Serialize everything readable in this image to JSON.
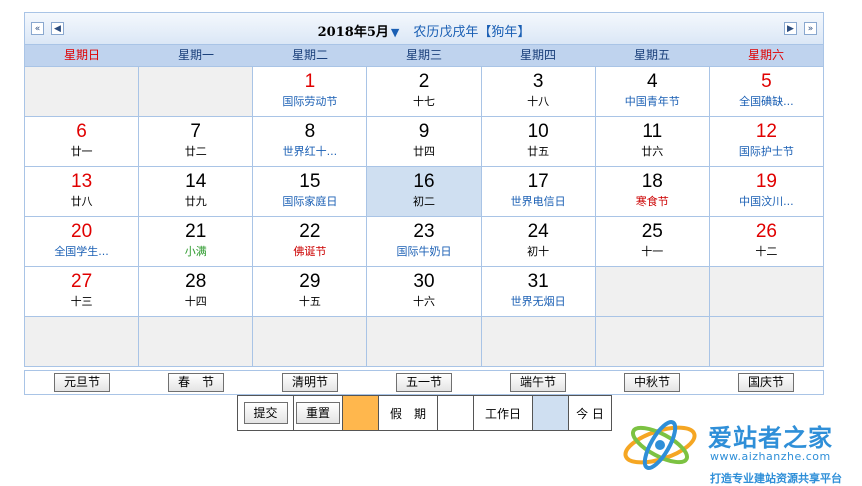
{
  "nav": {
    "prev_year": "«",
    "prev_month": "◀",
    "next_month": "▶",
    "next_year": "»"
  },
  "title": {
    "year_month": "2018年5月",
    "dropdown_arrow": "▼",
    "lunar": "农历戊戌年【狗年】"
  },
  "weekdays": [
    "星期日",
    "星期一",
    "星期二",
    "星期三",
    "星期四",
    "星期五",
    "星期六"
  ],
  "days": [
    {
      "num": "",
      "sub": "",
      "kind": "empty"
    },
    {
      "num": "",
      "sub": "",
      "kind": "empty"
    },
    {
      "num": "1",
      "sub": "国际劳动节",
      "kind": "fest",
      "red": true
    },
    {
      "num": "2",
      "sub": "十七",
      "kind": "lunar"
    },
    {
      "num": "3",
      "sub": "十八",
      "kind": "lunar"
    },
    {
      "num": "4",
      "sub": "中国青年节",
      "kind": "fest"
    },
    {
      "num": "5",
      "sub": "全国碘缺...",
      "kind": "fest",
      "red": true
    },
    {
      "num": "6",
      "sub": "廿一",
      "kind": "lunar",
      "red": true
    },
    {
      "num": "7",
      "sub": "廿二",
      "kind": "lunar"
    },
    {
      "num": "8",
      "sub": "世界红十...",
      "kind": "fest"
    },
    {
      "num": "9",
      "sub": "廿四",
      "kind": "lunar"
    },
    {
      "num": "10",
      "sub": "廿五",
      "kind": "lunar"
    },
    {
      "num": "11",
      "sub": "廿六",
      "kind": "lunar"
    },
    {
      "num": "12",
      "sub": "国际护士节",
      "kind": "fest",
      "red": true
    },
    {
      "num": "13",
      "sub": "廿八",
      "kind": "lunar",
      "red": true
    },
    {
      "num": "14",
      "sub": "廿九",
      "kind": "lunar"
    },
    {
      "num": "15",
      "sub": "国际家庭日",
      "kind": "fest"
    },
    {
      "num": "16",
      "sub": "初二",
      "kind": "lunar",
      "today": true
    },
    {
      "num": "17",
      "sub": "世界电信日",
      "kind": "fest"
    },
    {
      "num": "18",
      "sub": "寒食节",
      "kind": "trad"
    },
    {
      "num": "19",
      "sub": "中国汶川...",
      "kind": "fest",
      "red": true
    },
    {
      "num": "20",
      "sub": "全国学生...",
      "kind": "fest",
      "red": true
    },
    {
      "num": "21",
      "sub": "小满",
      "kind": "term"
    },
    {
      "num": "22",
      "sub": "佛诞节",
      "kind": "trad"
    },
    {
      "num": "23",
      "sub": "国际牛奶日",
      "kind": "fest"
    },
    {
      "num": "24",
      "sub": "初十",
      "kind": "lunar"
    },
    {
      "num": "25",
      "sub": "十一",
      "kind": "lunar"
    },
    {
      "num": "26",
      "sub": "十二",
      "kind": "lunar",
      "red": true
    },
    {
      "num": "27",
      "sub": "十三",
      "kind": "lunar",
      "red": true
    },
    {
      "num": "28",
      "sub": "十四",
      "kind": "lunar"
    },
    {
      "num": "29",
      "sub": "十五",
      "kind": "lunar"
    },
    {
      "num": "30",
      "sub": "十六",
      "kind": "lunar"
    },
    {
      "num": "31",
      "sub": "世界无烟日",
      "kind": "fest"
    },
    {
      "num": "",
      "sub": "",
      "kind": "empty"
    },
    {
      "num": "",
      "sub": "",
      "kind": "empty"
    },
    {
      "num": "",
      "sub": "",
      "kind": "empty"
    },
    {
      "num": "",
      "sub": "",
      "kind": "empty"
    },
    {
      "num": "",
      "sub": "",
      "kind": "empty"
    },
    {
      "num": "",
      "sub": "",
      "kind": "empty"
    },
    {
      "num": "",
      "sub": "",
      "kind": "empty"
    },
    {
      "num": "",
      "sub": "",
      "kind": "empty"
    },
    {
      "num": "",
      "sub": "",
      "kind": "empty"
    }
  ],
  "festival_buttons": [
    "元旦节",
    "春　节",
    "清明节",
    "五一节",
    "端午节",
    "中秋节",
    "国庆节"
  ],
  "bottom": {
    "submit": "提交",
    "reset": "重置",
    "holiday_label": "假　期",
    "workday_label": "工作日",
    "today_label": "今 日"
  },
  "colors": {
    "holiday_swatch": "#ffb74d",
    "workday_swatch": "#ffffff",
    "today_swatch": "#cfdff1",
    "weekend_red": "#e00000",
    "festival_blue": "#1a5fb4"
  },
  "watermark": {
    "name": "爱站者之家",
    "url": "www.aizhanzhe.com",
    "tagline": "打造专业建站资源共享平台"
  }
}
